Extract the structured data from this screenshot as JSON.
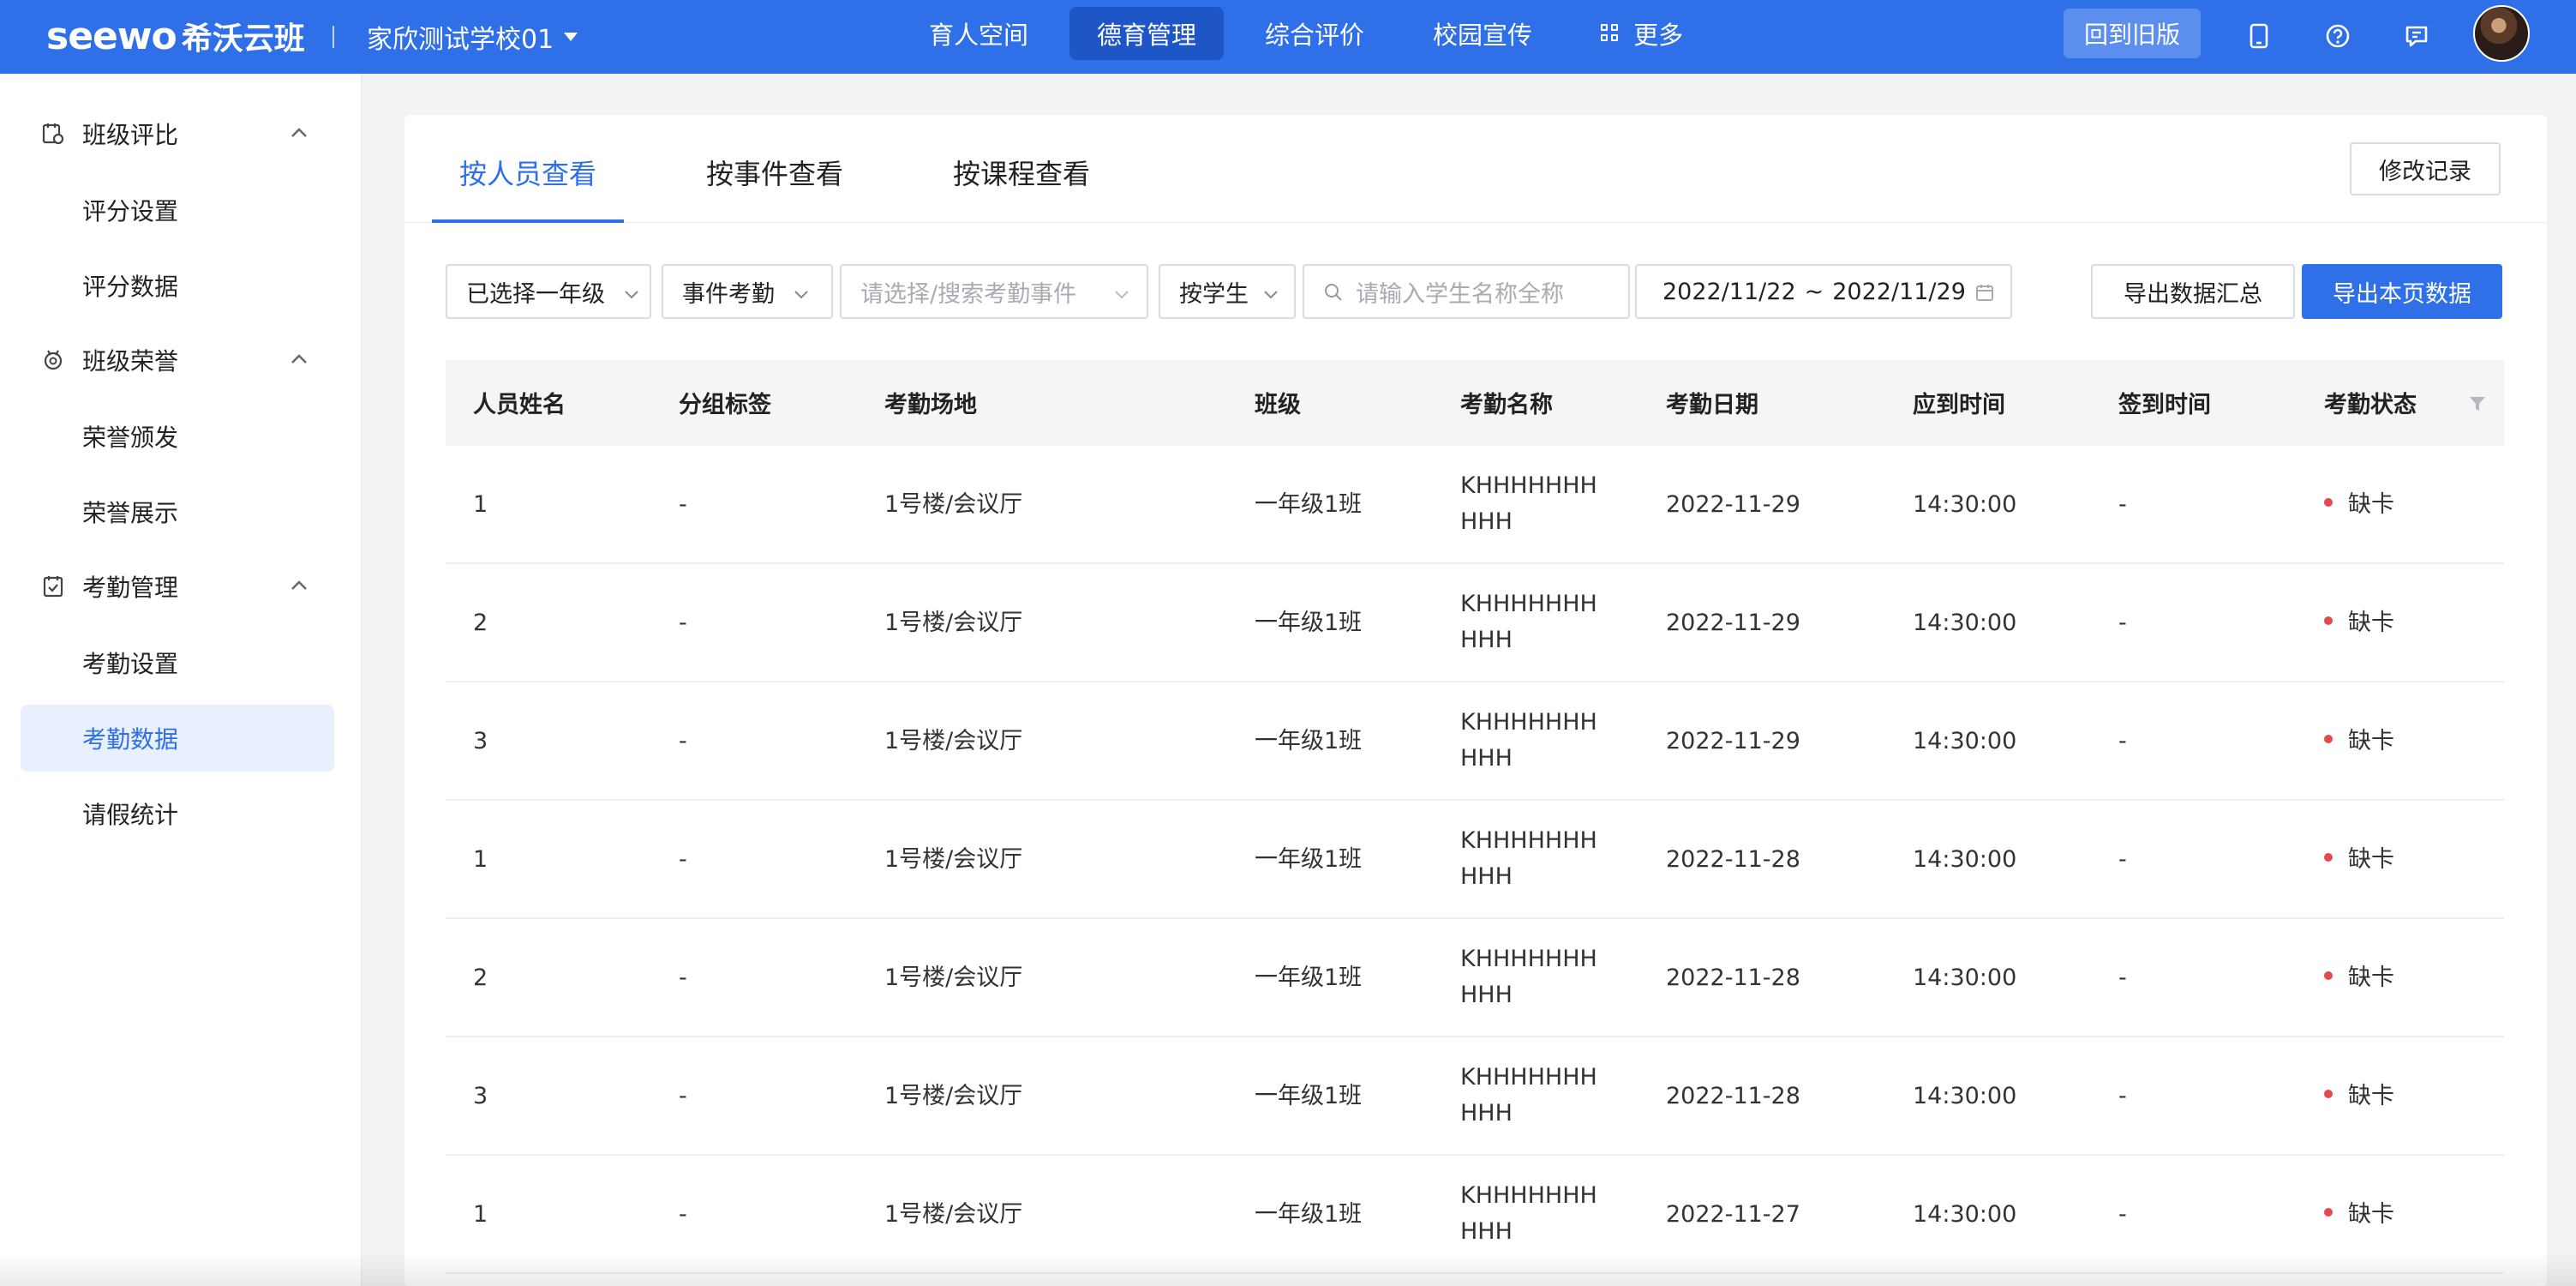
{
  "brand": {
    "logo_text": "seewo",
    "logo_cn": "希沃云班"
  },
  "header": {
    "school": "家欣测试学校01",
    "nav": [
      {
        "label": "育人空间",
        "active": false
      },
      {
        "label": "德育管理",
        "active": true
      },
      {
        "label": "综合评价",
        "active": false
      },
      {
        "label": "校园宣传",
        "active": false
      },
      {
        "label": "更多",
        "active": false
      }
    ],
    "old_version_label": "回到旧版",
    "icons": [
      "tablet-icon",
      "help-icon",
      "message-icon"
    ]
  },
  "sidebar": {
    "groups": [
      {
        "label": "班级评比",
        "icon": "class-rating-icon",
        "items": [
          {
            "label": "评分设置"
          },
          {
            "label": "评分数据"
          }
        ]
      },
      {
        "label": "班级荣誉",
        "icon": "medal-icon",
        "items": [
          {
            "label": "荣誉颁发"
          },
          {
            "label": "荣誉展示"
          }
        ]
      },
      {
        "label": "考勤管理",
        "icon": "attendance-icon",
        "items": [
          {
            "label": "考勤设置"
          },
          {
            "label": "考勤数据",
            "active": true
          },
          {
            "label": "请假统计"
          }
        ]
      }
    ]
  },
  "tabs": [
    {
      "label": "按人员查看",
      "active": true
    },
    {
      "label": "按事件查看",
      "active": false
    },
    {
      "label": "按课程查看",
      "active": false
    }
  ],
  "modify_record_label": "修改记录",
  "filters": {
    "grade": "已选择一年级",
    "type": "事件考勤",
    "event_placeholder": "请选择/搜索考勤事件",
    "by": "按学生",
    "search_placeholder": "请输入学生名称全称",
    "date_start": "2022/11/22",
    "date_sep": "~",
    "date_end": "2022/11/29"
  },
  "actions": {
    "export_summary": "导出数据汇总",
    "export_page": "导出本页数据"
  },
  "table": {
    "columns": [
      "人员姓名",
      "分组标签",
      "考勤场地",
      "班级",
      "考勤名称",
      "考勤日期",
      "应到时间",
      "签到时间",
      "考勤状态"
    ],
    "rows": [
      {
        "name": "1",
        "group": "-",
        "place": "1号楼/会议厅",
        "class": "一年级1班",
        "event_line1": "KHHHHHHH",
        "event_line2": "HHH",
        "date": "2022-11-29",
        "due": "14:30:00",
        "checkin": "-",
        "status": "缺卡"
      },
      {
        "name": "2",
        "group": "-",
        "place": "1号楼/会议厅",
        "class": "一年级1班",
        "event_line1": "KHHHHHHH",
        "event_line2": "HHH",
        "date": "2022-11-29",
        "due": "14:30:00",
        "checkin": "-",
        "status": "缺卡"
      },
      {
        "name": "3",
        "group": "-",
        "place": "1号楼/会议厅",
        "class": "一年级1班",
        "event_line1": "KHHHHHHH",
        "event_line2": "HHH",
        "date": "2022-11-29",
        "due": "14:30:00",
        "checkin": "-",
        "status": "缺卡"
      },
      {
        "name": "1",
        "group": "-",
        "place": "1号楼/会议厅",
        "class": "一年级1班",
        "event_line1": "KHHHHHHH",
        "event_line2": "HHH",
        "date": "2022-11-28",
        "due": "14:30:00",
        "checkin": "-",
        "status": "缺卡"
      },
      {
        "name": "2",
        "group": "-",
        "place": "1号楼/会议厅",
        "class": "一年级1班",
        "event_line1": "KHHHHHHH",
        "event_line2": "HHH",
        "date": "2022-11-28",
        "due": "14:30:00",
        "checkin": "-",
        "status": "缺卡"
      },
      {
        "name": "3",
        "group": "-",
        "place": "1号楼/会议厅",
        "class": "一年级1班",
        "event_line1": "KHHHHHHH",
        "event_line2": "HHH",
        "date": "2022-11-28",
        "due": "14:30:00",
        "checkin": "-",
        "status": "缺卡"
      },
      {
        "name": "1",
        "group": "-",
        "place": "1号楼/会议厅",
        "class": "一年级1班",
        "event_line1": "KHHHHHHH",
        "event_line2": "HHH",
        "date": "2022-11-27",
        "due": "14:30:00",
        "checkin": "-",
        "status": "缺卡"
      }
    ]
  },
  "colors": {
    "brand": "#2f6fe8",
    "status_missing": "#e5484d"
  }
}
